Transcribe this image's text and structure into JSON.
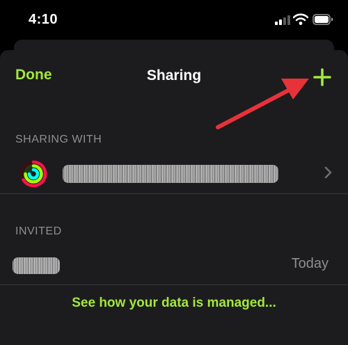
{
  "status_bar": {
    "time": "4:10"
  },
  "nav": {
    "done_label": "Done",
    "title": "Sharing"
  },
  "sections": {
    "sharing_with": {
      "header": "SHARING WITH"
    },
    "invited": {
      "header": "INVITED",
      "invite_date": "Today"
    }
  },
  "footer": {
    "link_label": "See how your data is managed..."
  },
  "colors": {
    "accent": "#a4e83d",
    "annotation_arrow": "#e8323a"
  },
  "icons": [
    "signal-icon",
    "wifi-icon",
    "battery-icon",
    "add-icon",
    "activity-rings-icon",
    "chevron-right-icon"
  ]
}
